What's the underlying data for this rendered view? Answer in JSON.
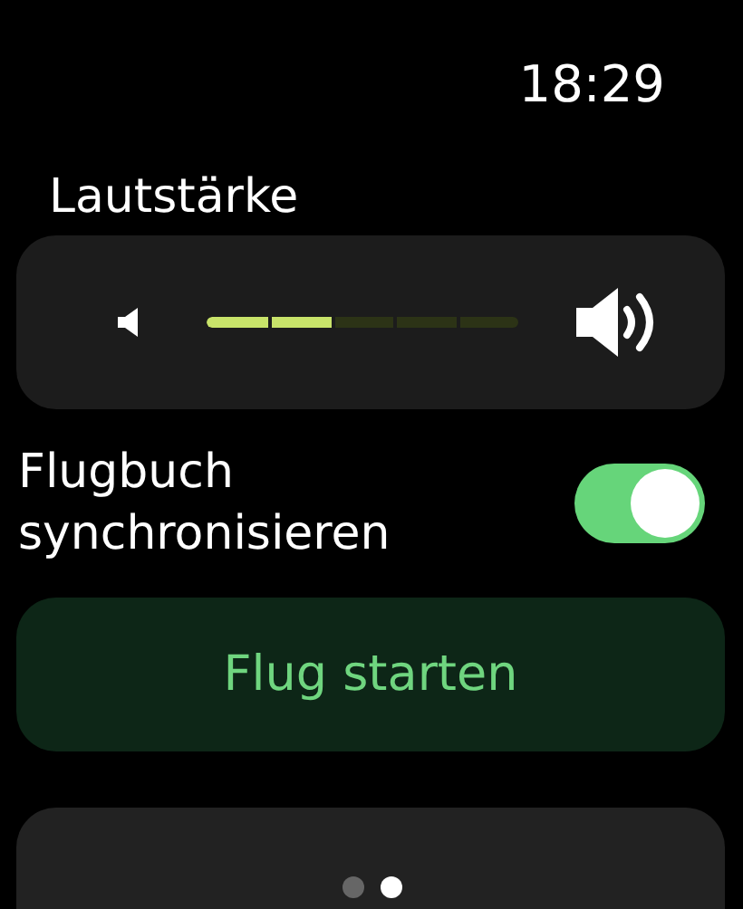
{
  "status_bar": {
    "time": "18:29"
  },
  "volume": {
    "title": "Lautstärke",
    "level": 0.4
  },
  "sync_toggle": {
    "label": "Flugbuch synchronisieren",
    "on": true
  },
  "buttons": [
    {
      "label": "Flug starten",
      "kind": "primary"
    },
    {
      "kind": "secondary"
    }
  ],
  "page_dots": [
    {
      "selected": false
    },
    {
      "selected": true
    }
  ]
}
